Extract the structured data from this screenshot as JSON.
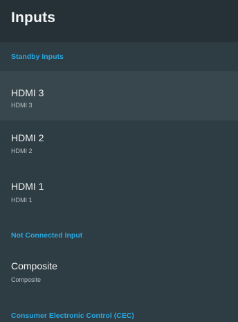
{
  "page": {
    "title": "Inputs"
  },
  "sections": [
    {
      "header": "Standby Inputs",
      "items": [
        {
          "title": "HDMI 3",
          "subtitle": "HDMI 3",
          "focused": true
        },
        {
          "title": "HDMI 2",
          "subtitle": "HDMI 2",
          "focused": false
        },
        {
          "title": "HDMI 1",
          "subtitle": "HDMI 1",
          "focused": false
        }
      ]
    },
    {
      "header": "Not Connected Input",
      "items": [
        {
          "title": "Composite",
          "subtitle": "Composite",
          "focused": false
        }
      ]
    },
    {
      "header": "Consumer Electronic Control (CEC)",
      "items": []
    }
  ],
  "colors": {
    "background": "#2e3c43",
    "header_background": "#263137",
    "focused_row": "#38474e",
    "section_header": "#29a8e0",
    "text_primary": "#f2f4f5",
    "text_secondary": "#b8c0c4"
  }
}
